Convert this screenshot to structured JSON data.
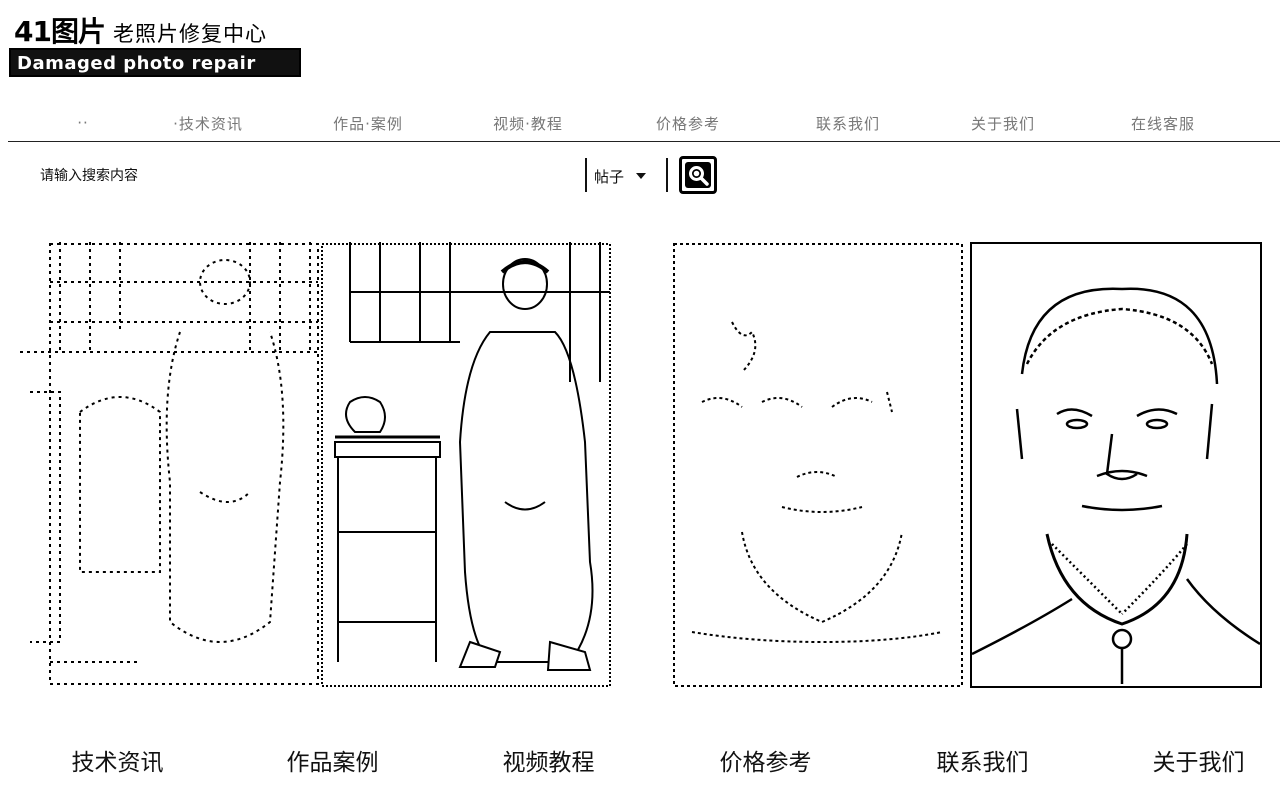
{
  "logo": {
    "mark": "41图片",
    "slogan": "老照片修复中心",
    "badge_text": "Damaged photo repair"
  },
  "top_nav": {
    "items": [
      {
        "label": "··"
      },
      {
        "label": "·技术资讯"
      },
      {
        "label": "作品·案例"
      },
      {
        "label": "视频·教程"
      },
      {
        "label": "价格参考"
      },
      {
        "label": "联系我们"
      },
      {
        "label": "关于我们"
      },
      {
        "label": "在线客服"
      }
    ]
  },
  "search": {
    "placeholder": "请输入搜索内容",
    "value": "",
    "category": "帖子"
  },
  "bottom_nav": {
    "items": [
      {
        "label": "技术资讯"
      },
      {
        "label": "作品案例"
      },
      {
        "label": "视频教程"
      },
      {
        "label": "价格参考"
      },
      {
        "label": "联系我们"
      },
      {
        "label": "关于我们"
      }
    ]
  }
}
